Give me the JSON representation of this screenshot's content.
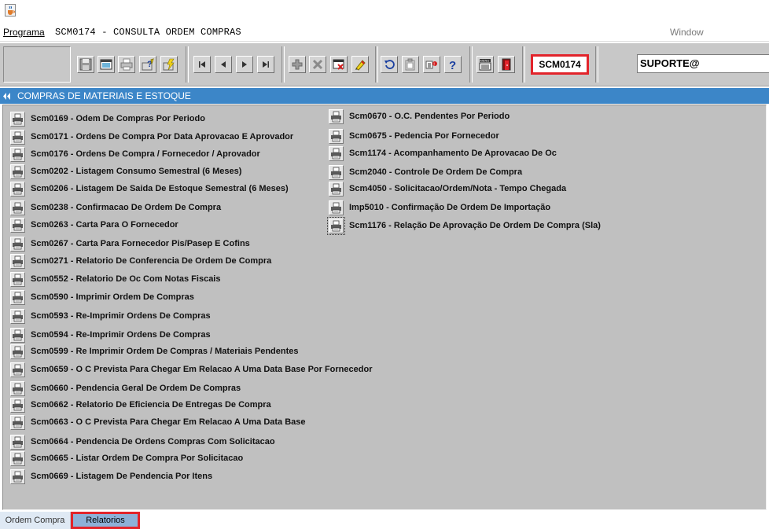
{
  "window": {
    "app_icon": "java-cup-icon"
  },
  "menubar": {
    "programa": "Programa",
    "title": "SCM0174 - CONSULTA ORDEM COMPRAS",
    "window": "Window"
  },
  "toolbar": {
    "program_code": "SCM0174",
    "user": "SUPORTE@",
    "buttons": [
      "save-icon",
      "window-icon",
      "print-icon",
      "query-help-icon",
      "execute-query-icon",
      "first-record-icon",
      "previous-record-icon",
      "next-record-icon",
      "last-record-icon",
      "insert-record-icon",
      "delete-record-icon",
      "clear-form-icon",
      "edit-icon",
      "undo-icon",
      "clipboard-icon",
      "key-help-icon",
      "help-icon",
      "menu-icon",
      "exit-icon"
    ]
  },
  "section": {
    "title": "COMPRAS DE MATERIAIS E ESTOQUE"
  },
  "reports_left": [
    "Scm0169 - Odem De Compras Por Periodo",
    "Scm0171 - Ordens De Compra Por Data Aprovacao  E Aprovador",
    "Scm0176 - Ordens De Compra / Fornecedor / Aprovador",
    "Scm0202 - Listagem Consumo Semestral (6 Meses)",
    "Scm0206 - Listagem De Saida De Estoque Semestral (6 Meses)",
    "Scm0238  - Confirmacao De Ordem De Compra",
    "Scm0263 - Carta Para O Fornecedor",
    "Scm0267 - Carta Para Fornecedor Pis/Pasep E Cofins",
    "Scm0271 - Relatorio De Conferencia De Ordem De Compra",
    "Scm0552 - Relatorio De Oc Com Notas Fiscais",
    "Scm0590 - Imprimir Ordem De Compras",
    "Scm0593 - Re-Imprimir Ordens De Compras",
    "Scm0594 - Re-Imprimir Ordens De Compras",
    "Scm0599 - Re Imprimir Ordem De Compras / Materiais Pendentes",
    "Scm0659 - O C Prevista Para Chegar Em Relacao A Uma Data Base Por Fornecedor",
    "Scm0660 - Pendencia Geral De Ordem De Compras",
    "Scm0662 - Relatorio De Eficiencia De Entregas De Compra",
    "Scm0663 - O C Prevista Para Chegar Em Relacao A Uma Data Base",
    "Scm0664 - Pendencia De Ordens Compras Com Solicitacao",
    "Scm0665 - Listar Ordem De Compra Por Solicitacao",
    "Scm0669 - Listagem De Pendencia Por Itens"
  ],
  "reports_right": [
    "Scm0670 - O.C. Pendentes Por Periodo",
    "Scm0675 - Pedencia Por Fornecedor",
    "Scm1174 - Acompanhamento De Aprovacao De Oc",
    "Scm2040 - Controle De Ordem De Compra",
    "Scm4050 - Solicitacao/Ordem/Nota - Tempo Chegada",
    "Imp5010 - Confirmação De Ordem De Importação",
    "Scm1176 - Relação De Aprovação De Ordem De Compra (Sla)"
  ],
  "tabs": {
    "ordem_compra": "Ordem Compra",
    "relatorios": "Relatorios"
  }
}
